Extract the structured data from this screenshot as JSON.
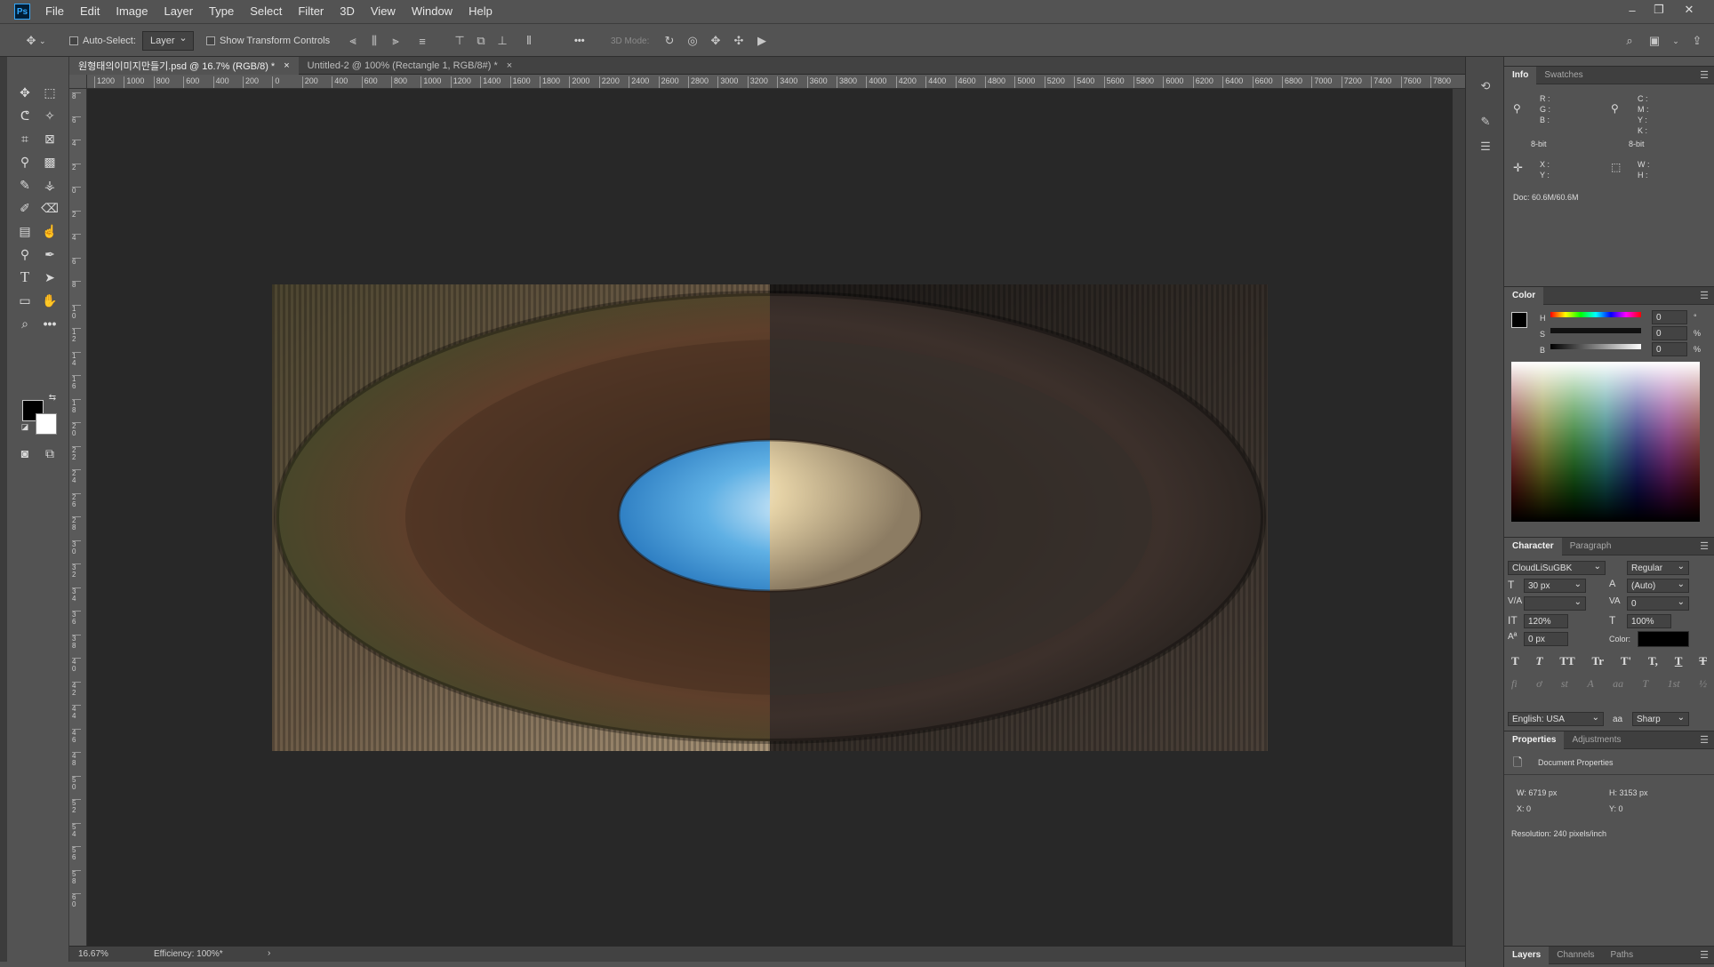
{
  "menubar": {
    "logo": "Ps",
    "items": [
      "File",
      "Edit",
      "Image",
      "Layer",
      "Type",
      "Select",
      "Filter",
      "3D",
      "View",
      "Window",
      "Help"
    ]
  },
  "window_controls": {
    "minimize": "–",
    "restore": "❐",
    "close": "✕"
  },
  "options": {
    "auto_select_label": "Auto-Select:",
    "auto_select_target": "Layer",
    "show_transform_label": "Show Transform Controls",
    "more": "•••",
    "mode_3d_label": "3D Mode:"
  },
  "tabs": [
    {
      "label": "원형태의이미지만들기.psd @ 16.7% (RGB/8) *",
      "close": "×"
    },
    {
      "label": "Untitled-2 @ 100% (Rectangle 1, RGB/8#) *",
      "close": "×"
    }
  ],
  "ruler": {
    "h_ticks": [
      "1200",
      "1000",
      "800",
      "600",
      "400",
      "200",
      "0",
      "200",
      "400",
      "600",
      "800",
      "1000",
      "1200",
      "1400",
      "1600",
      "1800",
      "2000",
      "2200",
      "2400",
      "2600",
      "2800",
      "3000",
      "3200",
      "3400",
      "3600",
      "3800",
      "4000",
      "4200",
      "4400",
      "4600",
      "4800",
      "5000",
      "5200",
      "5400",
      "5600",
      "5800",
      "6000",
      "6200",
      "6400",
      "6600",
      "6800",
      "7000",
      "7200",
      "7400",
      "7600",
      "7800"
    ],
    "v_ticks": [
      "8",
      "6",
      "4",
      "2",
      "0",
      "2",
      "4",
      "6",
      "8",
      "1 0",
      "1 2",
      "1 4",
      "1 6",
      "1 8",
      "2 0",
      "2 2",
      "2 4",
      "2 6",
      "2 8",
      "3 0",
      "3 2",
      "3 4",
      "3 6",
      "3 8",
      "4 0",
      "4 2",
      "4 4",
      "4 6",
      "4 8",
      "5 0",
      "5 2",
      "5 4",
      "5 6",
      "5 8",
      "6 0"
    ]
  },
  "status": {
    "zoom": "16.67%",
    "efficiency": "Efficiency: 100%*",
    "arrow": "›"
  },
  "info_panel": {
    "tabs": [
      "Info",
      "Swatches"
    ],
    "rgb": "R :\nG :\nB :",
    "cmyk": "C :\nM :\nY :\nK :",
    "bit_left": "8-bit",
    "bit_right": "8-bit",
    "xy": "X :\nY :",
    "wh": "W :\nH :",
    "doc": "Doc: 60.6M/60.6M"
  },
  "color_panel": {
    "title": "Color",
    "h_label": "H",
    "s_label": "S",
    "b_label": "B",
    "h_value": "0",
    "s_value": "0",
    "b_value": "0",
    "h_unit": "°",
    "s_unit": "%",
    "b_unit": "%"
  },
  "character_panel": {
    "tabs": [
      "Character",
      "Paragraph"
    ],
    "font": "CloudLiSuGBK",
    "style": "Regular",
    "size": "30 px",
    "leading": "(Auto)",
    "tracking": "0",
    "vscale": "120%",
    "hscale": "100%",
    "baseline": "0 px",
    "color_label": "Color:",
    "language": "English: USA",
    "aa_label": "aa",
    "antialias": "Sharp",
    "type_styles": [
      "T",
      "T",
      "TT",
      "Tr",
      "T'",
      "T,",
      "T",
      "T"
    ],
    "opentype": [
      "fi",
      "ơ",
      "st",
      "A",
      "aa",
      "T",
      "1st",
      "½"
    ]
  },
  "properties_panel": {
    "tabs": [
      "Properties",
      "Adjustments"
    ],
    "doc_label": "Document Properties",
    "w": "W:  6719 px",
    "h": "H:  3153 px",
    "x": "X:  0",
    "y": "Y:  0",
    "resolution": "Resolution: 240 pixels/inch"
  },
  "layers_panel": {
    "tabs": [
      "Layers",
      "Channels",
      "Paths"
    ]
  },
  "colors": {
    "ui_bg": "#535353",
    "canvas_bg": "#282828",
    "accent": "#31a8ff"
  }
}
